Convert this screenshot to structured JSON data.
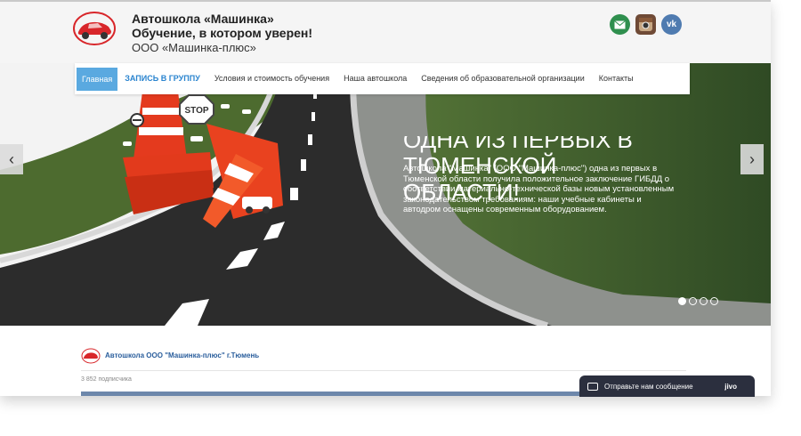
{
  "header": {
    "title": "Автошкола «Машинка»",
    "slogan": "Обучение, в котором уверен!",
    "company": "ООО «Машинка-плюс»",
    "social": [
      {
        "icon": "mail-icon",
        "color": "#2f8f4e"
      },
      {
        "icon": "instagram-icon",
        "color": "#6f4a36"
      },
      {
        "icon": "vk-icon",
        "label": "vk",
        "color": "#4f7bb0"
      }
    ]
  },
  "nav": {
    "items": [
      {
        "label": "Главная",
        "active": true
      },
      {
        "label": "ЗАПИСЬ В ГРУППУ",
        "cta": true
      },
      {
        "label": "Условия и стоимость обучения"
      },
      {
        "label": "Наша автошкола"
      },
      {
        "label": "Сведения об образовательной организации"
      },
      {
        "label": "Контакты"
      }
    ],
    "accent_color": "#5aa9e0"
  },
  "slider": {
    "title_lines": [
      "ОДНА ИЗ ПЕРВЫХ В",
      "ТЮМЕНСКОЙ",
      "ОБЛАСТИ!"
    ],
    "text": "Автошкола \"Машинка\" (ООО \"Машинка-плюс\") одна из первых в Тюменской области получила положительное заключение ГИБДД о соответствии материально-технической базы новым установленным законодательством требованиям: наши учебные кабинеты и автодром оснащены современным оборудованием.",
    "prev_icon": "chevron-left-icon",
    "next_icon": "chevron-right-icon",
    "prev_label": "‹",
    "next_label": "›",
    "dots": 4,
    "active_dot": 1,
    "sign_text": "STOP"
  },
  "widget": {
    "title": "Автошкола ООО \"Машинка-плюс\" г.Тюмень",
    "subscribers": "3 852 подписчика"
  },
  "jivo": {
    "message": "Отправьте нам сообщение",
    "brand": "jivo"
  }
}
